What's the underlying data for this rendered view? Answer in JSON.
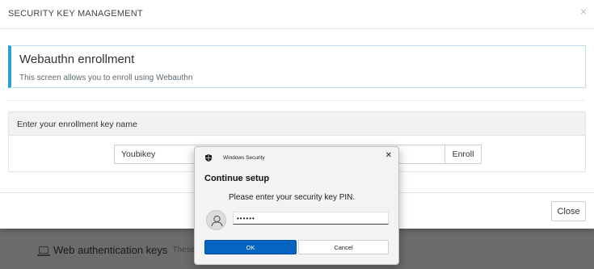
{
  "modal": {
    "title": "SECURITY KEY MANAGEMENT",
    "close_glyph": "×",
    "alert": {
      "heading": "Webauthn enrollment",
      "text": "This screen allows you to enroll using Webauthn"
    },
    "enroll_panel": {
      "heading": "Enter your enrollment key name",
      "key_name_value": "Youbikey",
      "enroll_label": "Enroll"
    },
    "close_label": "Close"
  },
  "background": {
    "section_title": "Web authentication keys",
    "section_subtitle": "These are"
  },
  "windows_security": {
    "app_name": "Windows Security",
    "close_glyph": "✕",
    "heading": "Continue setup",
    "message": "Please enter your security key PIN.",
    "pin_value": "••••••",
    "ok_label": "OK",
    "cancel_label": "Cancel"
  },
  "colors": {
    "accent": "#2a9fd6",
    "primary_button": "#0563c1"
  }
}
